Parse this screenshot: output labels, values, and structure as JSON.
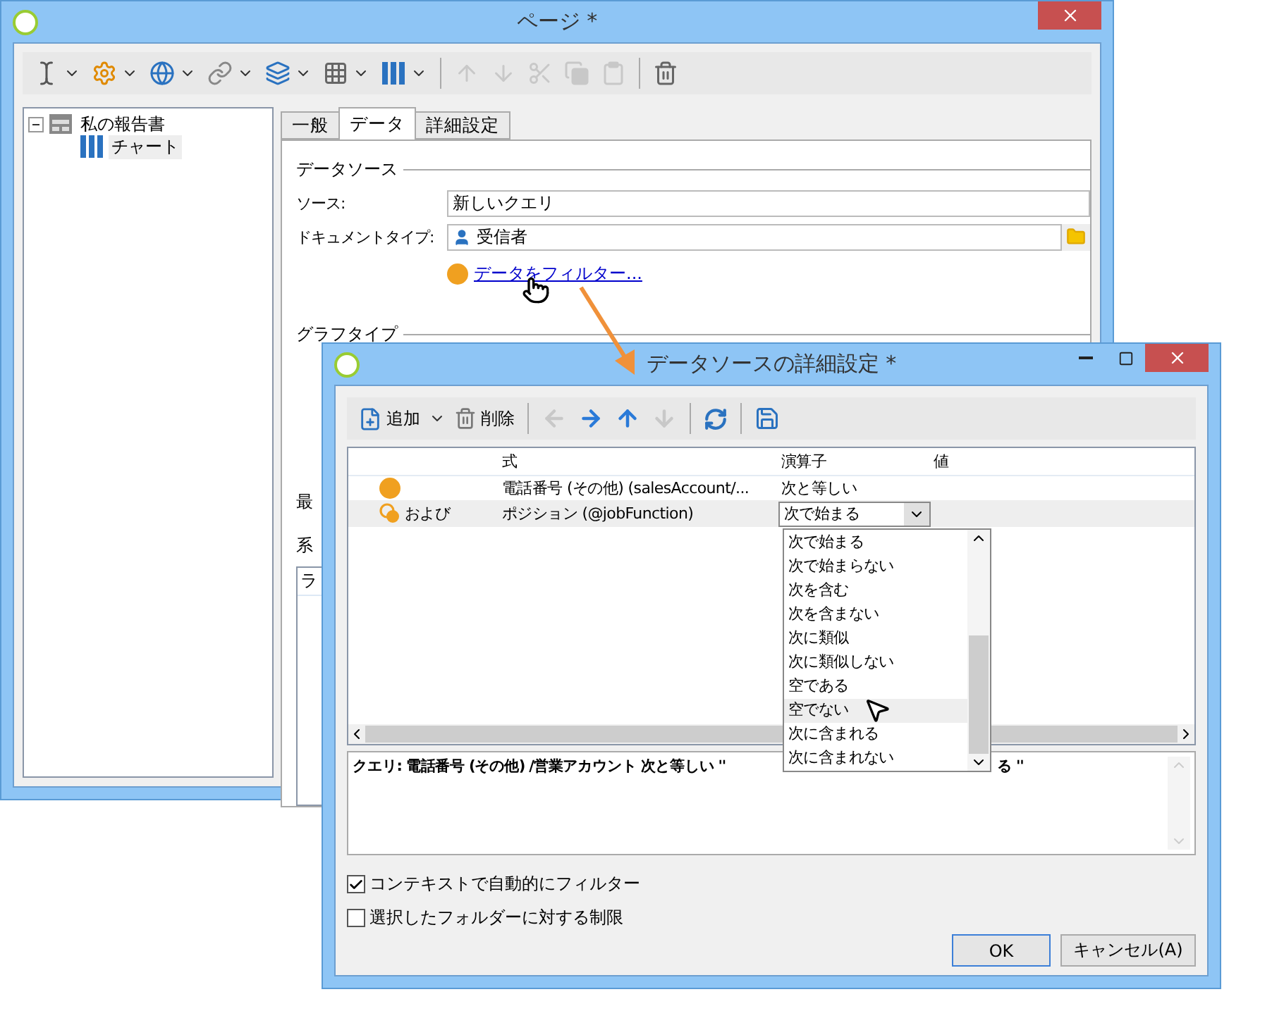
{
  "page_window": {
    "title": "ページ *",
    "toolbar": [
      {
        "kind": "text-cursor",
        "dropdown": true,
        "disabled": false
      },
      {
        "kind": "field-gear",
        "dropdown": true,
        "disabled": false
      },
      {
        "kind": "globe",
        "dropdown": true,
        "disabled": false
      },
      {
        "kind": "link",
        "dropdown": true,
        "disabled": false
      },
      {
        "kind": "layers",
        "dropdown": true,
        "disabled": false
      },
      {
        "kind": "grid",
        "dropdown": true,
        "disabled": false
      },
      {
        "kind": "bars",
        "dropdown": true,
        "disabled": false
      },
      {
        "kind": "separator"
      },
      {
        "kind": "up",
        "dropdown": false,
        "disabled": true
      },
      {
        "kind": "down",
        "dropdown": false,
        "disabled": true
      },
      {
        "kind": "cut",
        "dropdown": false,
        "disabled": true
      },
      {
        "kind": "copy",
        "dropdown": false,
        "disabled": true
      },
      {
        "kind": "paste",
        "dropdown": false,
        "disabled": true
      },
      {
        "kind": "separator"
      },
      {
        "kind": "trash",
        "dropdown": false,
        "disabled": false
      }
    ],
    "tree": [
      {
        "label": "私の報告書",
        "expanded": true,
        "selected": false,
        "children": [
          {
            "label": "チャート",
            "selected": true
          }
        ]
      }
    ],
    "tabs": [
      {
        "label": "一般",
        "selected": false
      },
      {
        "label": "データ",
        "selected": true
      },
      {
        "label": "詳細設定",
        "selected": false
      }
    ],
    "data_source": {
      "heading": "データソース",
      "source_label": "ソース:",
      "source_value": "新しいクエリ",
      "doctype_label": "ドキュメントタイプ:",
      "doctype_value": "受信者",
      "filter_link": "データをフィルター..."
    },
    "graph_type": {
      "heading": "グラフタイプ"
    },
    "partial_labels": [
      "最",
      "系"
    ],
    "series_table": {
      "column_1": "ラ"
    }
  },
  "dialog": {
    "title": "データソースの詳細設定 *",
    "add_button": "追加",
    "delete_button": "削除",
    "nav": [
      {
        "kind": "left",
        "disabled": true
      },
      {
        "kind": "right",
        "disabled": false
      },
      {
        "kind": "up",
        "disabled": false
      },
      {
        "kind": "down",
        "disabled": true
      }
    ],
    "columns": [
      "式",
      "演算子",
      "値"
    ],
    "rows": [
      {
        "kind": "condition",
        "conjunction": "",
        "expression": "電話番号 (その他) (salesAccount/...",
        "operator": "次と等しい",
        "selected": false
      },
      {
        "kind": "and-condition",
        "conjunction": "および",
        "expression": "ポジション (@jobFunction)",
        "operator": "次で始まる",
        "selected": true
      }
    ],
    "operator_options": [
      {
        "label": "次で始まる",
        "hovered": false
      },
      {
        "label": "次で始まらない",
        "hovered": false
      },
      {
        "label": "次を含む",
        "hovered": false
      },
      {
        "label": "次を含まない",
        "hovered": false
      },
      {
        "label": "次に類似",
        "hovered": false
      },
      {
        "label": "次に類似しない",
        "hovered": false
      },
      {
        "label": "空である",
        "hovered": false
      },
      {
        "label": "空でない",
        "hovered": true
      },
      {
        "label": "次に含まれる",
        "hovered": false
      },
      {
        "label": "次に含まれない",
        "hovered": false
      }
    ],
    "query_start": "クエリ: 電話番号 (その他) /営業アカウント 次と等しい ''",
    "query_end": "る ''",
    "checkboxes": [
      {
        "label": "コンテキストで自動的にフィルター",
        "checked": true
      },
      {
        "label": "選択したフォルダーに対する制限",
        "checked": false
      }
    ],
    "buttons": [
      {
        "label": "OK",
        "kind": "default"
      },
      {
        "label": "キャンセル(A)",
        "kind": "normal"
      }
    ]
  }
}
